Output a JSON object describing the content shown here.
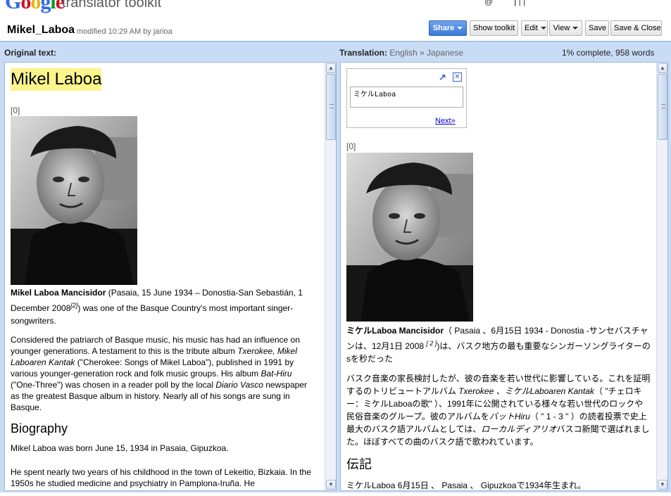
{
  "header": {
    "logo_letters": [
      {
        "ch": "G",
        "color": "#3369e8"
      },
      {
        "ch": "o",
        "color": "#d50f25"
      },
      {
        "ch": "o",
        "color": "#eeb211"
      },
      {
        "ch": "g",
        "color": "#3369e8"
      },
      {
        "ch": "l",
        "color": "#009925"
      },
      {
        "ch": "e",
        "color": "#d50f25"
      }
    ],
    "product": "translator toolkit",
    "user_fragment": "@",
    "user_links": [
      "",
      "",
      ""
    ]
  },
  "document": {
    "title": "Mikel_Laboa",
    "meta": "modified 10:29 AM  by jarioa"
  },
  "toolbar": {
    "share": "Share",
    "show_toolkit": "Show toolkit",
    "edit": "Edit",
    "view": "View",
    "save": "Save",
    "save_close": "Save & Close"
  },
  "panels": {
    "original_label": "Original text:",
    "translation_label": "Translation:",
    "languages": "English » Japanese",
    "progress": "1% complete,   958 words"
  },
  "original": {
    "heading": "Mikel Laboa",
    "ref": "[0]",
    "p1_bold": "Mikel Laboa Mancisidor",
    "p1_text": " (Pasaia, 15 June 1934 – Donostia-San Sebastián, 1 December 2008",
    "p1_sup": "[2]",
    "p1_tail": ") was one of the Basque Country's most important singer-songwriters.",
    "p2_a": "Considered the patriarch of Basque music, his music has had an influence on younger generations. A testament to this is the tribute album ",
    "p2_i1": "Txerokee, Mikel Laboaren Kantak",
    "p2_b": " (\"Cherokee: Songs of Mikel Laboa\"), published in 1991 by various younger-generation rock and folk music groups. His album ",
    "p2_i2": "Bat-Hiru",
    "p2_c": " (\"One-Three\") was chosen in a reader poll by the local ",
    "p2_i3": "Diario Vasco",
    "p2_d": " newspaper as the greatest Basque album in history. Nearly all of his songs are sung in Basque.",
    "section": "Biography",
    "p3": "Mikel Laboa was born June 15, 1934 in Pasaia, Gipuzkoa.",
    "p4": "He spent nearly two years of his childhood in the town of Lekeitio, Bizkaia. In the 1950s he studied medicine and psychiatry in Pamplona-Iruña. He"
  },
  "translation": {
    "popup_text": "ミケルLaboa",
    "popup_next": "Next»",
    "ref": "[0]",
    "p1_bold": "ミケルLaboa Mancisidor",
    "p1_text": "（ Pasaia 、6月15日 1934 - Donostia -サンセバスチャンは、12月1日 2008 ",
    "p1_sup": "[ 2 ]",
    "p1_tail": ")は、バスク地方の最も重要なシンガーソングライターのsを秒だった",
    "p2_a": "バスク音楽の家長検討したが、彼の音楽を若い世代に影響している。これを証明するのトリビュートアルバム ",
    "p2_i1": "Txerokee 、ミケルLaboaren Kantak",
    "p2_b": "（ \"チェロキー：ミケルLaboaの歌\" ）、1991年に公開されている様々な若い世代のロックや民俗音楽のグループ。彼のアルバムを",
    "p2_i2": "バットHiru",
    "p2_c": "（ \" 1 - 3 \" ）の読者投票で史上最大のバスク語アルバムとしては、",
    "p2_i3": "ローカルディアリオ",
    "p2_d": "バスコ新聞で選ばれました。ほぼすべての曲のバスク語で歌われています。",
    "section": "伝記",
    "p3": "ミケルLaboa 6月15日 、 Pasaia 、 Gipuzkoaで1934年生まれ。"
  }
}
